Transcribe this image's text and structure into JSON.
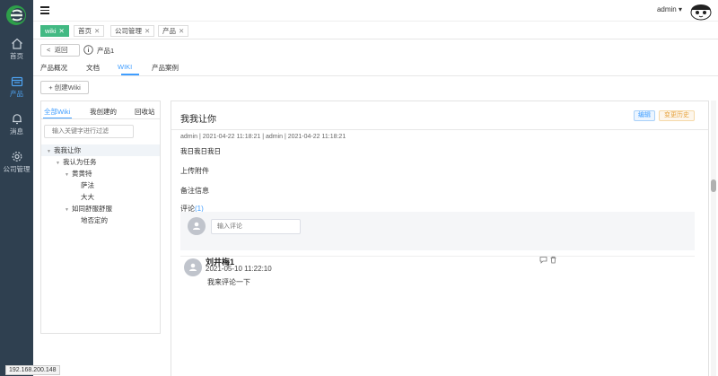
{
  "sidebar": {
    "items": [
      {
        "label": "首页",
        "icon": "home-icon"
      },
      {
        "label": "产品",
        "icon": "product-icon",
        "active": true
      },
      {
        "label": "消息",
        "icon": "bell-icon"
      },
      {
        "label": "公司管理",
        "icon": "gear-icon"
      }
    ]
  },
  "header": {
    "user": "admin ▾"
  },
  "tabs": [
    {
      "label": "wiki",
      "active": true
    },
    {
      "label": "首页"
    },
    {
      "label": "公司管理"
    },
    {
      "label": "产品"
    }
  ],
  "toolbar": {
    "back_label": "返回",
    "product_title": "产品1"
  },
  "subnav": [
    "产品概况",
    "文档",
    "WIKI",
    "产品案例"
  ],
  "create_label": "+ 创建Wiki",
  "wiki_tabs": [
    "全部Wiki",
    "我创建的",
    "回收站"
  ],
  "search": {
    "placeholder": "输入关键字进行过滤"
  },
  "tree": [
    {
      "label": "我我让你",
      "level": 0,
      "caret": true,
      "selected": true
    },
    {
      "label": "我认为任务",
      "level": 1,
      "caret": true
    },
    {
      "label": "黄黄特",
      "level": 2,
      "caret": true
    },
    {
      "label": "萨法",
      "level": 3,
      "caret": false
    },
    {
      "label": "大大",
      "level": 3,
      "caret": false
    },
    {
      "label": "如同舒服舒服",
      "level": 2,
      "caret": true
    },
    {
      "label": "地否定的",
      "level": 3,
      "caret": false
    }
  ],
  "wiki": {
    "title": "我我让你",
    "edit_label": "编辑",
    "history_label": "变更历史",
    "meta": "admin | 2021-04-22 11:18:21 | admin | 2021-04-22 11:18:21",
    "body": "我日我日我日",
    "attach_label": "上传附件",
    "notes_label": "备注信息",
    "comments_label": "评论",
    "comments_count": "(1)"
  },
  "comment_form": {
    "placeholder": "输入评论"
  },
  "comments": [
    {
      "author": "刘井梅1",
      "time": "2021-05-10 11:22:10",
      "text": "我来评论一下"
    }
  ],
  "status_url": "192.168.200.148",
  "colors": {
    "sidebar": "#2f4050",
    "accent": "#409eff",
    "tab_active": "#42b983"
  }
}
